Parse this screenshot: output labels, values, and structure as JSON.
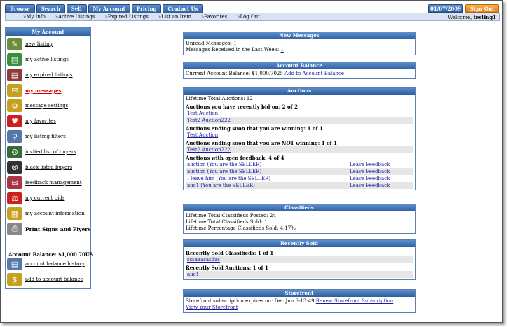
{
  "tabs": [
    "Browse",
    "Search",
    "Sell",
    "My Account",
    "Pricing",
    "Contact Us"
  ],
  "date": "01/07/2009",
  "sign_out": "Sign Out",
  "subnav": [
    "My Info",
    "Active Listings",
    "Expired Listings",
    "List an Item",
    "Favorites",
    "Log Out"
  ],
  "welcome_prefix": "Welcome,",
  "username": "testing1",
  "sidebar": {
    "title": "My Account",
    "items": [
      {
        "label": "new listing",
        "icon": "new-listing-icon",
        "color": "#6a8f3a",
        "glyph": "✎"
      },
      {
        "label": "my active listings",
        "icon": "active-listings-icon",
        "color": "#3a8f3a",
        "glyph": "▤"
      },
      {
        "label": "my expired listings",
        "icon": "expired-listings-icon",
        "color": "#8f3a3a",
        "glyph": "▤"
      },
      {
        "label": "my messages",
        "icon": "messages-icon",
        "color": "#c8a020",
        "glyph": "✉"
      },
      {
        "label": "message settings",
        "icon": "message-settings-icon",
        "color": "#c8a020",
        "glyph": "⚙"
      },
      {
        "label": "my favorites",
        "icon": "favorites-icon",
        "color": "#cc2020",
        "glyph": "♥"
      },
      {
        "label": "my listing filters",
        "icon": "listing-filters-icon",
        "color": "#5577aa",
        "glyph": "⚲"
      },
      {
        "label": "invited list of buyers",
        "icon": "invited-buyers-icon",
        "color": "#3a6a3a",
        "glyph": "☺"
      },
      {
        "label": "black listed buyers",
        "icon": "blacklisted-buyers-icon",
        "color": "#333333",
        "glyph": "☹"
      },
      {
        "label": "feedback management",
        "icon": "feedback-icon",
        "color": "#aa3344",
        "glyph": "✉"
      },
      {
        "label": "my current bids",
        "icon": "current-bids-icon",
        "color": "#cc2020",
        "glyph": "⚖"
      },
      {
        "label": "my account information",
        "icon": "account-info-icon",
        "color": "#c8a020",
        "glyph": "▦"
      },
      {
        "label": "Print Signs and Flyers",
        "icon": "print-icon",
        "color": "#888888",
        "glyph": "⎙"
      },
      {
        "label": "account balance history",
        "icon": "balance-history-icon",
        "color": "#5577aa",
        "glyph": "▤"
      },
      {
        "label": "add to account balance",
        "icon": "add-balance-icon",
        "color": "#c8a020",
        "glyph": "$"
      }
    ],
    "balance_label": "Account Balance: $1,000.70US"
  },
  "messages": {
    "title": "New Messages",
    "unread_label": "Unread Messages:",
    "unread_value": "1",
    "week_label": "Messages Received in the Last Week:",
    "week_value": "1"
  },
  "balance": {
    "title": "Account Balance",
    "current_label": "Current Account Balance: $1,000.7025",
    "add_link": "Add to Account Balance"
  },
  "auctions": {
    "title": "Auctions",
    "lifetime": "Lifetime Total Auctions: 12",
    "bid_title": "Auctions you have recently bid on: 2 of 2",
    "bid_items": [
      "Test Auction",
      "Test2 Auction222"
    ],
    "winning_title": "Auctions ending soon that you are winning: 1 of 1",
    "winning_items": [
      "Test Auction"
    ],
    "not_winning_title": "Auctions ending soon that you are NOT winning: 1 of 1",
    "not_winning_items": [
      "Test2 Auction222"
    ],
    "feedback_title": "Auctions with open feedback: 4 of 4",
    "feedback_items": [
      {
        "item": "auction (You are the SELLER)",
        "action": "Leave Feedback"
      },
      {
        "item": "auction (You are the SELLER)",
        "action": "Leave Feedback"
      },
      {
        "item": "I leave him (You are the SELLER)",
        "action": "Leave Feedback"
      },
      {
        "item": "auc1 (You are the SELLER)",
        "action": "Leave Feedback"
      }
    ]
  },
  "classifieds": {
    "title": "Classifieds",
    "lines": [
      "Lifetime Total Classifieds Posted: 24",
      "Lifetime Total Classifieds Sold: 1",
      "Lifetime Percentage Classifieds Sold: 4.17%"
    ]
  },
  "recently_sold": {
    "title": "Recently Sold",
    "classifieds_title": "Recently Sold Classifieds: 1 of 1",
    "classifieds_items": [
      "sssaaasasdas"
    ],
    "auctions_title": "Recently Sold Auctions: 1 of 1",
    "auctions_items": [
      "auc1"
    ]
  },
  "storefront": {
    "title": "Storefront",
    "text": "Storefront subscription expires on: Dec Jun 6-13:49",
    "renew_link": "Renew Storefront Subscription",
    "view_link": "View Your Storefront"
  }
}
